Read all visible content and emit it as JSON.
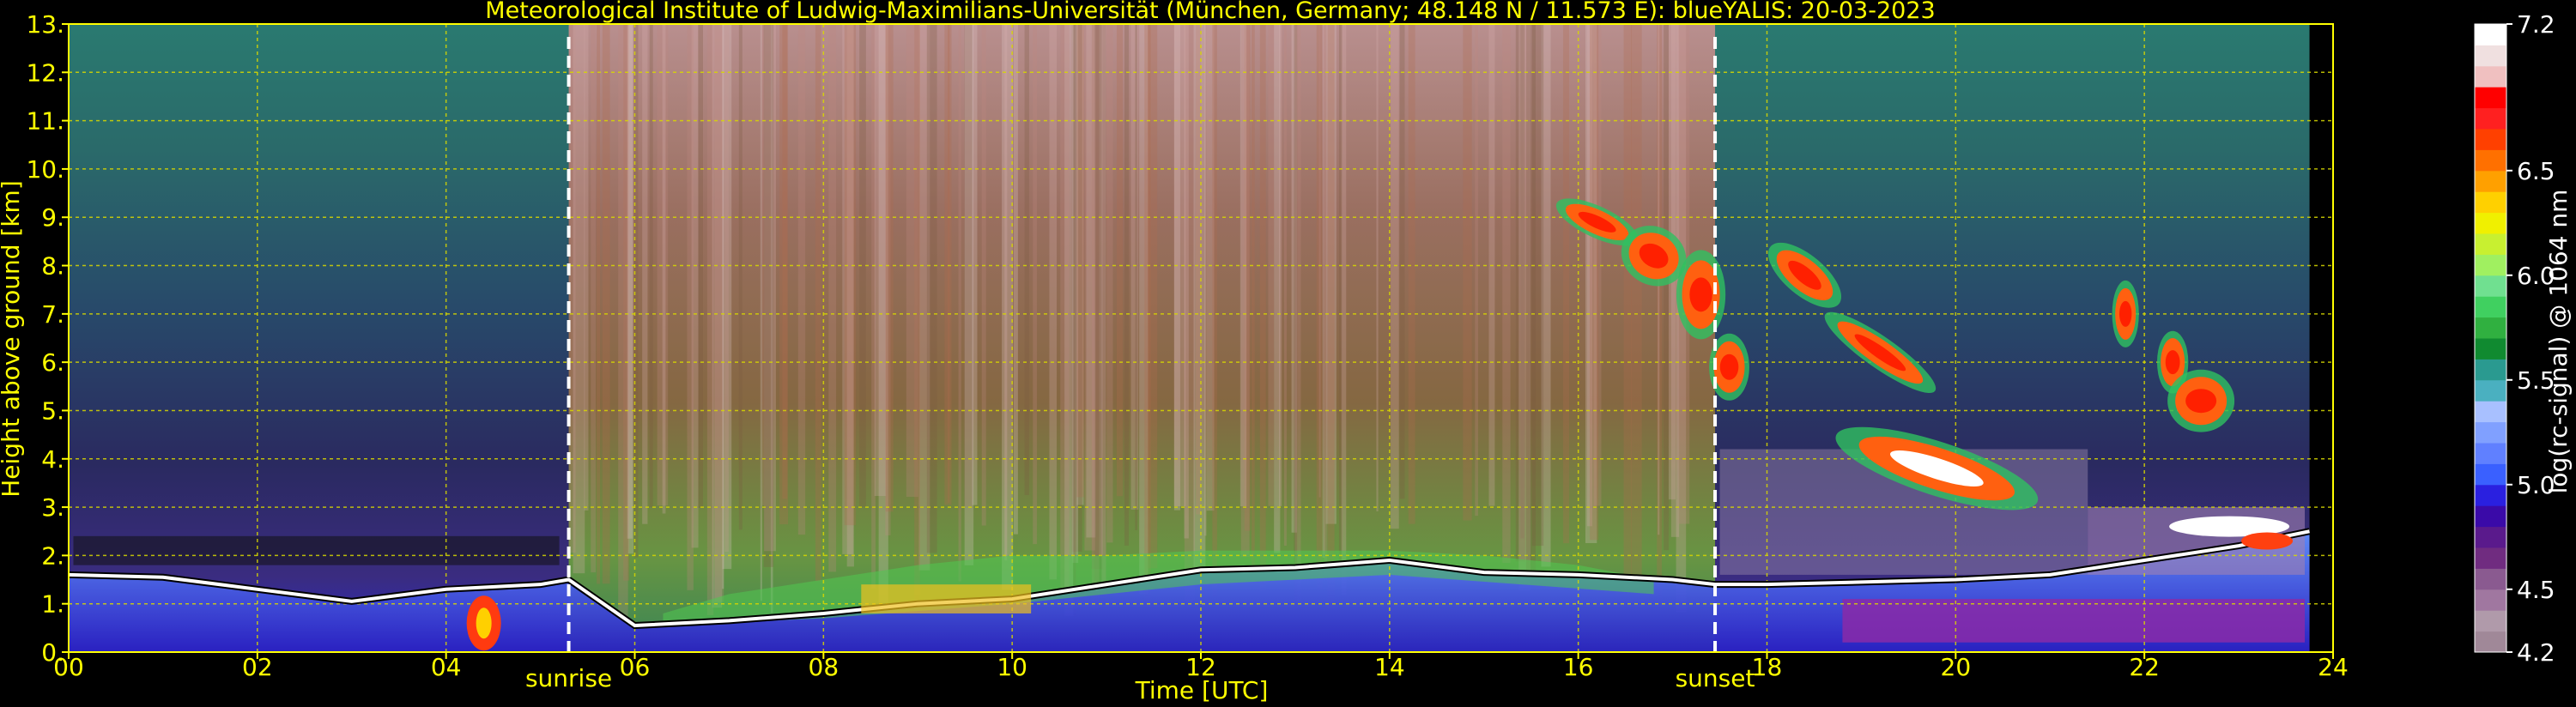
{
  "chart_data": {
    "type": "heatmap",
    "title": "Meteorological Institute of Ludwig-Maximilians-Universität (München, Germany; 48.148 N / 11.573 E):     blueYALIS: 20-03-2023",
    "xlabel": "Time [UTC]",
    "ylabel": "Height above ground [km]",
    "xlim": [
      0,
      24
    ],
    "ylim": [
      0,
      13
    ],
    "x_ticks": [
      "00",
      "02",
      "04",
      "06",
      "08",
      "10",
      "12",
      "14",
      "16",
      "18",
      "20",
      "22",
      "24"
    ],
    "y_ticks": [
      "0.",
      "1.",
      "2.",
      "3.",
      "4.",
      "5.",
      "6.",
      "7.",
      "8.",
      "9.",
      "10.",
      "11.",
      "12.",
      "13."
    ],
    "grid": true,
    "data_end_hour": 23.75,
    "markers": [
      {
        "label": "sunrise",
        "hour": 5.3
      },
      {
        "label": "sunset",
        "hour": 17.45
      }
    ],
    "colorbar": {
      "label": "log(rc-signal) @ 1064 nm",
      "range": [
        4.2,
        7.2
      ],
      "ticks": [
        "4.2",
        "4.5",
        "5.0",
        "5.5",
        "6.0",
        "6.5",
        "7.2"
      ],
      "colors": [
        "#a08898",
        "#b09aaa",
        "#a077a0",
        "#8a5a90",
        "#702c80",
        "#5a1a8c",
        "#3a0aa8",
        "#2a20e0",
        "#3a60ff",
        "#6080ff",
        "#80a0ff",
        "#a8c0ff",
        "#4ab0c0",
        "#2a9a90",
        "#108a30",
        "#30b040",
        "#40d060",
        "#70e090",
        "#a0f060",
        "#c8f030",
        "#f0f000",
        "#ffd000",
        "#ffa000",
        "#ff7000",
        "#ff4000",
        "#ff2020",
        "#ff0000",
        "#f0c0c0",
        "#f0e0e0",
        "#ffffff"
      ]
    },
    "layers": [
      {
        "name": "boundary layer top (km)",
        "x": [
          0,
          1,
          2,
          3,
          4,
          5,
          5.3,
          6,
          7,
          8,
          9,
          10,
          11,
          12,
          13,
          14,
          15,
          16,
          17,
          17.45,
          18,
          19,
          20,
          21,
          22,
          23,
          23.75
        ],
        "y": [
          1.6,
          1.55,
          1.3,
          1.05,
          1.3,
          1.4,
          1.5,
          0.55,
          0.65,
          0.8,
          1.0,
          1.1,
          1.4,
          1.7,
          1.75,
          1.9,
          1.65,
          1.6,
          1.5,
          1.4,
          1.4,
          1.45,
          1.5,
          1.6,
          1.9,
          2.2,
          2.5
        ]
      },
      {
        "name": "cirrus cloud",
        "x": [
          16.2,
          16.8,
          17.3,
          17.6,
          18.4,
          19.2,
          19.8,
          21.8,
          22.3,
          22.6
        ],
        "y": [
          8.9,
          8.2,
          7.4,
          5.9,
          7.8,
          6.2,
          3.8,
          7.0,
          6.0,
          5.2
        ]
      }
    ]
  }
}
